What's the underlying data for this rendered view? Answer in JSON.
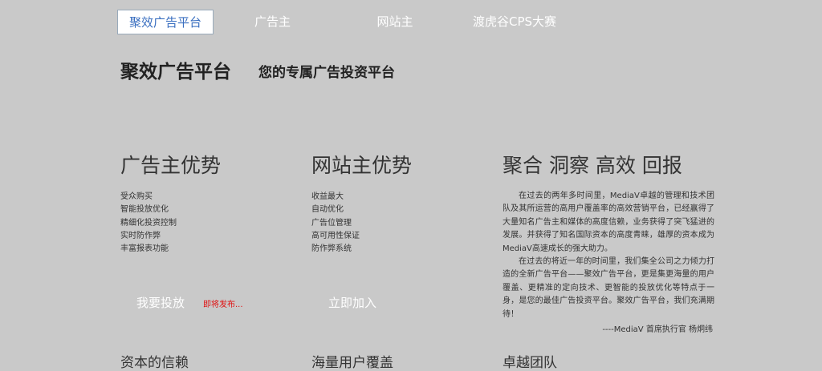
{
  "nav": {
    "items": [
      "聚效广告平台",
      "广告主",
      "网站主",
      "渡虎谷CPS大赛"
    ],
    "active": "聚效广告平台"
  },
  "header": {
    "brand": "聚效广告平台",
    "slogan": "您的专属广告投资平台"
  },
  "advertiser": {
    "title": "广告主优势",
    "features": [
      "受众购买",
      "智能投放优化",
      "精细化投资控制",
      "实时防作弊",
      "丰富报表功能"
    ],
    "button": "我要投放",
    "coming_soon": "即将发布..."
  },
  "publisher": {
    "title": "网站主优势",
    "features": [
      "收益最大",
      "自动优化",
      "广告位管理",
      "高可用性保证",
      "防作弊系统"
    ],
    "button": "立即加入"
  },
  "about": {
    "title": "聚合 洞察 高效 回报",
    "paragraph1": "在过去的两年多时间里，MediaV卓越的管理和技术团队及其所运营的高用户覆盖率的高效营销平台，已经赢得了大量知名广告主和媒体的高度信赖，业务获得了突飞猛进的发展。并获得了知名国际资本的高度青睐，雄厚的资本成为MediaV高速成长的强大助力。",
    "paragraph2": "在过去的将近一年的时间里，我们集全公司之力倾力打造的全新广告平台——聚效广告平台，更是集更海量的用户覆盖、更精准的定向技术、更智能的投放优化等特点于一身，是您的最佳广告投资平台。聚效广告平台，我们充满期待！",
    "signature": "----MediaV 首席执行官 杨炯纬"
  },
  "bottom": {
    "items": [
      "资本的信赖",
      "海量用户覆盖",
      "卓越团队"
    ]
  }
}
